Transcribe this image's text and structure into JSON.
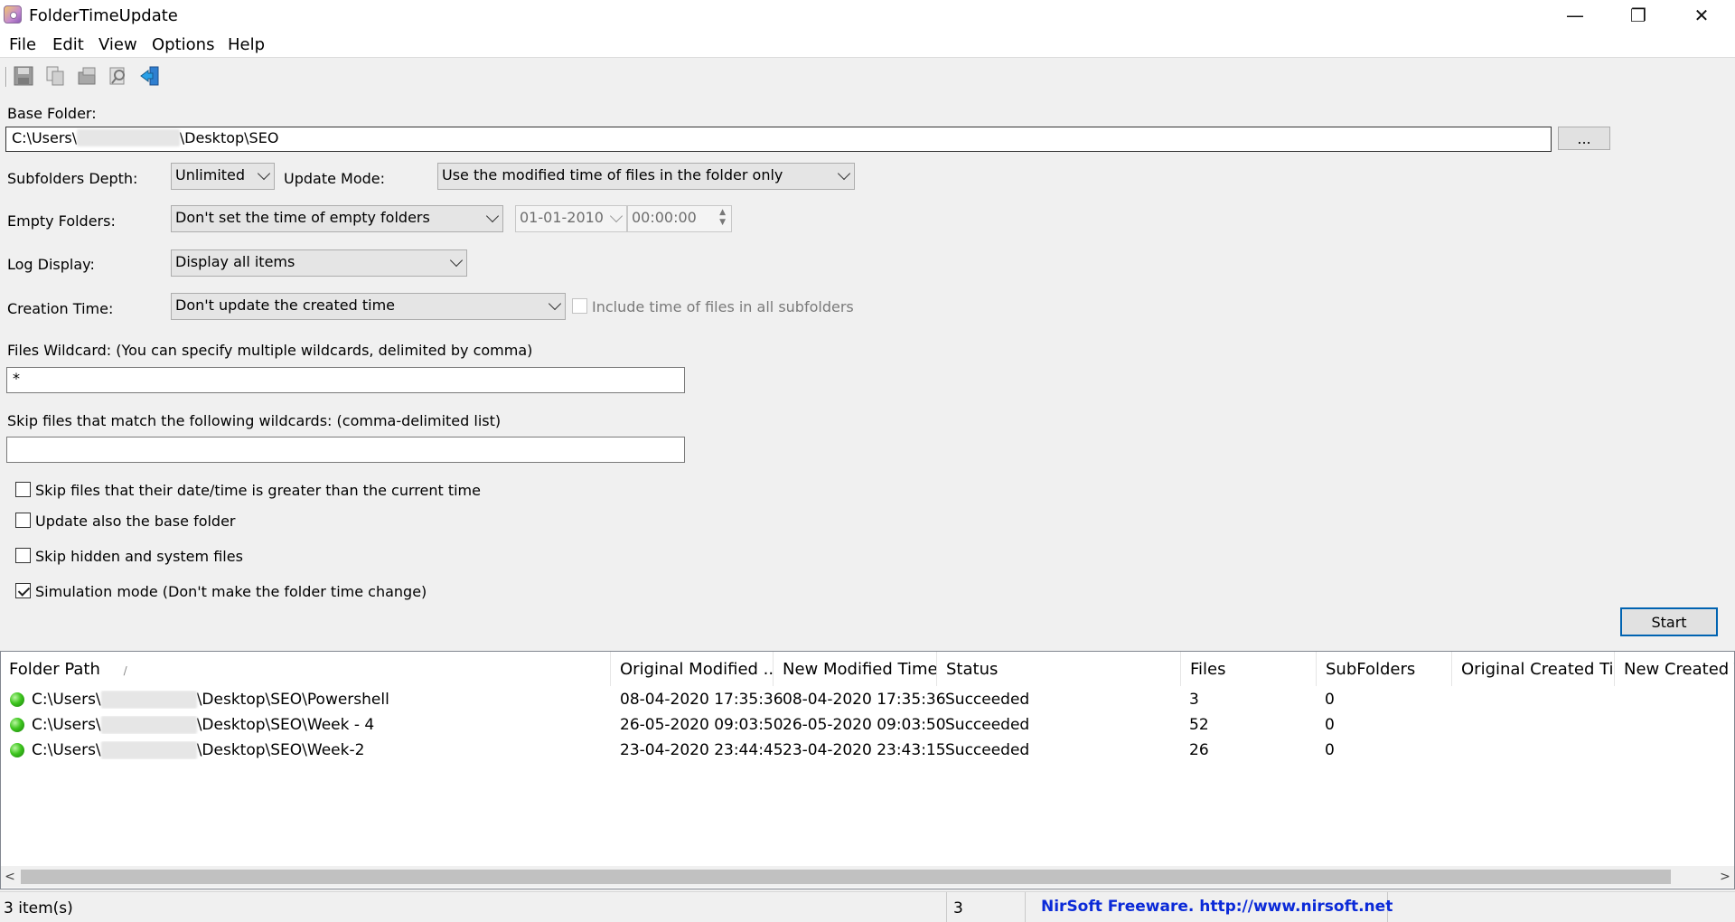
{
  "window": {
    "title": "FolderTimeUpdate",
    "controls": {
      "minimize": "—",
      "restore": "❐",
      "close": "✕"
    }
  },
  "menu": [
    "File",
    "Edit",
    "View",
    "Options",
    "Help"
  ],
  "toolbar": {
    "icons": [
      "save-icon",
      "copy-icon",
      "properties-icon",
      "find-icon",
      "exit-icon"
    ]
  },
  "form": {
    "base_folder_label": "Base Folder:",
    "base_folder_prefix": "C:\\Users\\",
    "base_folder_suffix": "\\Desktop\\SEO",
    "browse_label": "...",
    "subfolders_depth_label": "Subfolders Depth:",
    "subfolders_depth_value": "Unlimited",
    "update_mode_label": "Update Mode:",
    "update_mode_value": "Use the modified time of files in the folder only",
    "empty_folders_label": "Empty Folders:",
    "empty_folders_value": "Don't set the time of empty folders",
    "empty_date_value": "01-01-2010",
    "empty_time_value": "00:00:00",
    "log_display_label": "Log Display:",
    "log_display_value": "Display all items",
    "creation_time_label": "Creation Time:",
    "creation_time_value": "Don't update the created time",
    "include_subfolders_label": "Include time of files in all subfolders",
    "files_wildcard_label": "Files Wildcard: (You can specify multiple wildcards, delimited by comma)",
    "files_wildcard_value": "*",
    "skip_wildcards_label": "Skip files that match the following wildcards: (comma-delimited list)",
    "skip_wildcards_value": "",
    "checkboxes": [
      {
        "label": "Skip files that their date/time is greater than the current time",
        "checked": false
      },
      {
        "label": "Update also the base folder",
        "checked": false
      },
      {
        "label": "Skip hidden and system files",
        "checked": false
      },
      {
        "label": "Simulation mode (Don't make the folder time change)",
        "checked": true
      }
    ],
    "start_label": "Start"
  },
  "list": {
    "columns": [
      "Folder Path",
      "Original Modified ...",
      "New Modified Time",
      "Status",
      "Files",
      "SubFolders",
      "Original Created Ti...",
      "New Created Ti"
    ],
    "sort_indicator": "/",
    "rows": [
      {
        "path_prefix": "C:\\Users\\",
        "path_suffix": "\\Desktop\\SEO\\Powershell",
        "orig_modified": "08-04-2020 17:35:36",
        "new_modified": "08-04-2020 17:35:36",
        "status": "Succeeded",
        "files": "3",
        "subfolders": "0"
      },
      {
        "path_prefix": "C:\\Users\\",
        "path_suffix": "\\Desktop\\SEO\\Week - 4",
        "orig_modified": "26-05-2020 09:03:50",
        "new_modified": "26-05-2020 09:03:50",
        "status": "Succeeded",
        "files": "52",
        "subfolders": "0"
      },
      {
        "path_prefix": "C:\\Users\\",
        "path_suffix": "\\Desktop\\SEO\\Week-2",
        "orig_modified": "23-04-2020 23:44:45",
        "new_modified": "23-04-2020 23:43:15",
        "status": "Succeeded",
        "files": "26",
        "subfolders": "0"
      }
    ]
  },
  "status": {
    "items": "3 item(s)",
    "count": "3",
    "credit": "NirSoft Freeware.  http://www.nirsoft.net"
  },
  "colors": {
    "status_ok": "#3dc51e",
    "link": "#0b2ad8"
  }
}
